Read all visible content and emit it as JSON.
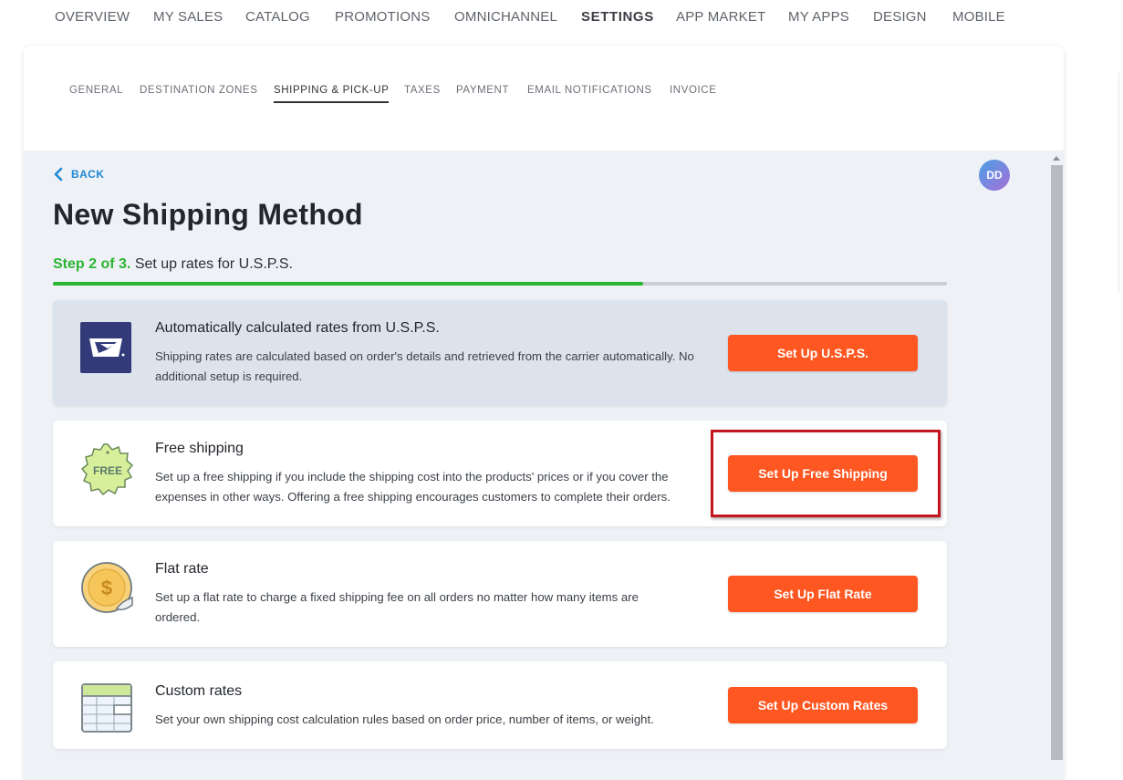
{
  "top_nav": {
    "items": [
      "OVERVIEW",
      "MY SALES",
      "CATALOG",
      "PROMOTIONS",
      "OMNICHANNEL",
      "SETTINGS",
      "APP MARKET",
      "MY APPS",
      "DESIGN",
      "MOBILE"
    ],
    "active": "SETTINGS"
  },
  "sub_nav": {
    "tabs": [
      "GENERAL",
      "DESTINATION ZONES",
      "SHIPPING & PICK-UP",
      "TAXES",
      "PAYMENT",
      "EMAIL NOTIFICATIONS",
      "INVOICE"
    ],
    "active": "SHIPPING & PICK-UP"
  },
  "back_label": "BACK",
  "avatar_initials": "DD",
  "page_title": "New Shipping Method",
  "step": {
    "prefix": "Step 2 of 3.",
    "text": "Set up rates for U.S.P.S.",
    "progress_fraction": 0.66
  },
  "cards": [
    {
      "icon": "usps-eagle-icon",
      "title": "Automatically calculated rates from U.S.P.S.",
      "description": "Shipping rates are calculated based on order's details and retrieved from the carrier automatically. No additional setup is required.",
      "button": "Set Up U.S.P.S.",
      "featured": true
    },
    {
      "icon": "free-badge-icon",
      "icon_text": "FREE",
      "title": "Free shipping",
      "description": "Set up a free shipping if you include the shipping cost into the products' prices or if you cover the expenses in other ways. Offering a free shipping encourages customers to complete their orders.",
      "button": "Set Up Free Shipping",
      "highlighted": true
    },
    {
      "icon": "dollar-coin-icon",
      "icon_text": "$",
      "title": "Flat rate",
      "description": "Set up a flat rate to charge a fixed shipping fee on all orders no matter how many items are ordered.",
      "button": "Set Up Flat Rate"
    },
    {
      "icon": "table-grid-icon",
      "title": "Custom rates",
      "description": "Set your own shipping cost calculation rules based on order price, number of items, or weight.",
      "button": "Set Up Custom Rates"
    }
  ],
  "colors": {
    "accent_button": "#ff5722",
    "progress_green": "#2cb532",
    "link_blue": "#1e88d4",
    "highlight_red": "#c4161c"
  }
}
